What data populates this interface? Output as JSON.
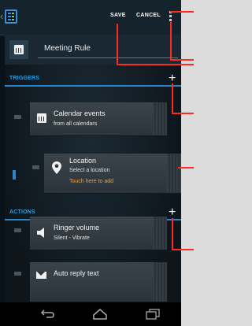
{
  "actionbar": {
    "save_label": "SAVE",
    "cancel_label": "CANCEL"
  },
  "rule": {
    "name": "Meeting Rule"
  },
  "triggers": {
    "header": "TRIGGERS",
    "add_symbol": "+",
    "items": [
      {
        "title": "Calendar events",
        "subtitle": "from all calendars",
        "icon": "calendar-icon"
      },
      {
        "title": "Location",
        "subtitle": "Select a location",
        "hint": "Touch here to add",
        "icon": "location-pin-icon"
      }
    ]
  },
  "actions": {
    "header": "ACTIONS",
    "add_symbol": "+",
    "items": [
      {
        "title": "Ringer volume",
        "subtitle": "Silent - Vibrate",
        "icon": "speaker-icon"
      },
      {
        "title": "Auto reply text",
        "icon": "mail-icon"
      }
    ]
  },
  "colors": {
    "accent": "#2e9be0",
    "hint": "#f0a030",
    "callout": "#ff2a20"
  },
  "navbar": {
    "icons": [
      "back-icon",
      "home-icon",
      "recents-icon"
    ]
  }
}
